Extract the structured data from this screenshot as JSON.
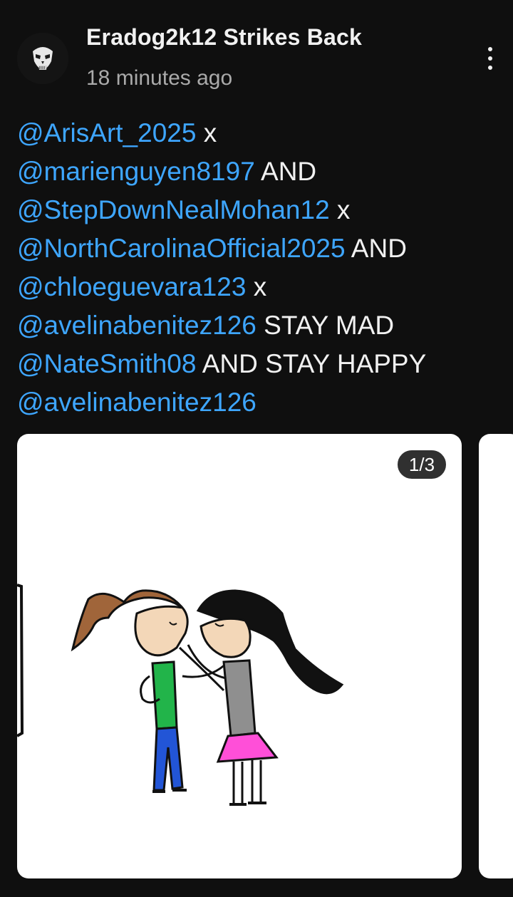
{
  "post": {
    "channel_name": "Eradog2k12 Strikes Back",
    "time": "18 minutes ago",
    "avatar_icon": "skull-avatar-icon",
    "menu_icon": "more-vertical-icon",
    "lines": [
      {
        "mention": "@ArisArt_2025",
        "text": " x"
      },
      {
        "mention": "@marienguyen8197",
        "text": " AND"
      },
      {
        "mention": "@StepDownNealMohan12",
        "text": " x"
      },
      {
        "mention": "@NorthCarolinaOfficial2025",
        "text": " AND"
      },
      {
        "mention": "@chloeguevara123",
        "text": " x"
      },
      {
        "mention": "@avelinabenitez126",
        "text": " STAY MAD"
      },
      {
        "mention": "@NateSmith08",
        "text": " AND STAY HAPPY"
      },
      {
        "mention": "@avelinabenitez126",
        "text": ""
      }
    ]
  },
  "carousel": {
    "counter": "1/3"
  },
  "colors": {
    "background": "#0f0f0f",
    "mention": "#3ea6ff",
    "text": "#f1f1f1",
    "secondary_text": "#aaaaaa"
  }
}
